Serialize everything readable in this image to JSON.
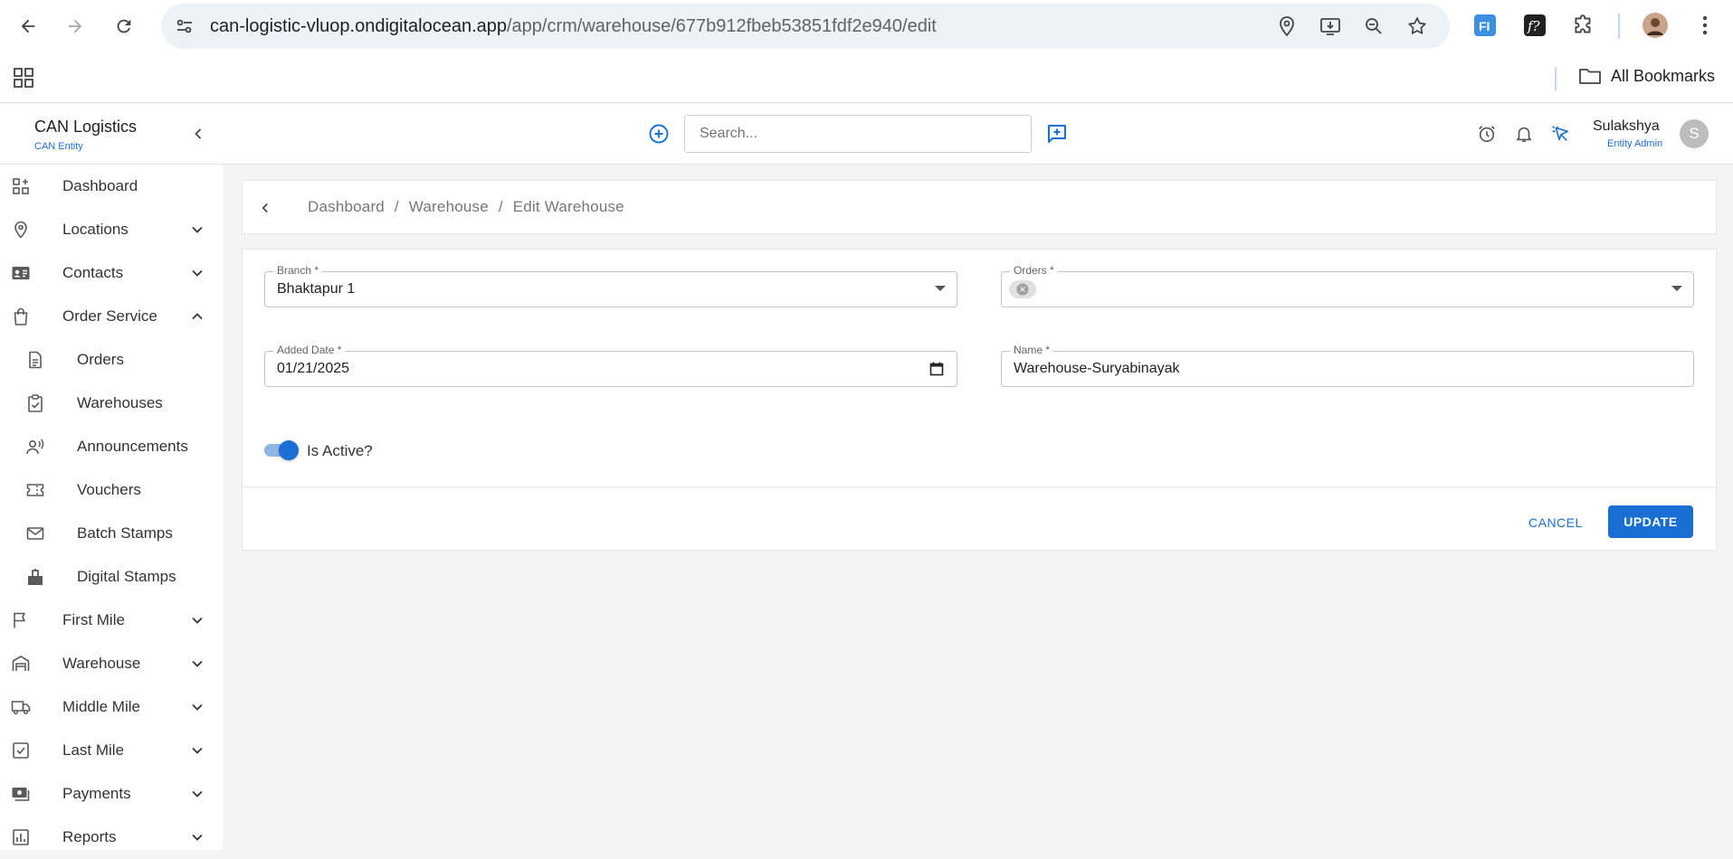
{
  "browser": {
    "url_host": "can-logistic-vluop.ondigitalocean.app",
    "url_path": "/app/crm/warehouse/677b912fbeb53851fdf2e940/edit",
    "bookmarks_label": "All Bookmarks"
  },
  "header": {
    "brand_title": "CAN Logistics",
    "brand_subtitle": "CAN Entity",
    "search_placeholder": "Search...",
    "user_name": "Sulakshya",
    "user_role": "Entity Admin",
    "avatar_initial": "S"
  },
  "sidebar": {
    "items": [
      {
        "label": "Dashboard",
        "icon": "dashboard-icon"
      },
      {
        "label": "Locations",
        "icon": "location-pin-icon"
      },
      {
        "label": "Contacts",
        "icon": "contact-card-icon"
      },
      {
        "label": "Order Service",
        "icon": "shopping-bag-icon"
      },
      {
        "label": "Orders",
        "icon": "document-icon"
      },
      {
        "label": "Warehouses",
        "icon": "clipboard-check-icon"
      },
      {
        "label": "Announcements",
        "icon": "announcement-icon"
      },
      {
        "label": "Vouchers",
        "icon": "ticket-icon"
      },
      {
        "label": "Batch Stamps",
        "icon": "mail-icon"
      },
      {
        "label": "Digital Stamps",
        "icon": "stamp-icon"
      },
      {
        "label": "First Mile",
        "icon": "flag-icon"
      },
      {
        "label": "Warehouse",
        "icon": "warehouse-icon"
      },
      {
        "label": "Middle Mile",
        "icon": "truck-icon"
      },
      {
        "label": "Last Mile",
        "icon": "checkbox-icon"
      },
      {
        "label": "Payments",
        "icon": "payments-icon"
      },
      {
        "label": "Reports",
        "icon": "bar-chart-icon"
      }
    ]
  },
  "breadcrumb": {
    "dashboard": "Dashboard",
    "sep1": "/",
    "warehouse": "Warehouse",
    "sep2": "/",
    "current": "Edit Warehouse"
  },
  "form": {
    "branch_label": "Branch *",
    "branch_value": "Bhaktapur 1",
    "orders_label": "Orders *",
    "added_date_label": "Added Date *",
    "added_date_value": "01/21/2025",
    "name_label": "Name *",
    "name_value": "Warehouse-Suryabinayak",
    "is_active_label": "Is Active?",
    "is_active": true,
    "cancel_label": "CANCEL",
    "update_label": "UPDATE"
  },
  "colors": {
    "accent": "#1a6fd4",
    "background": "#f4f4f4"
  }
}
